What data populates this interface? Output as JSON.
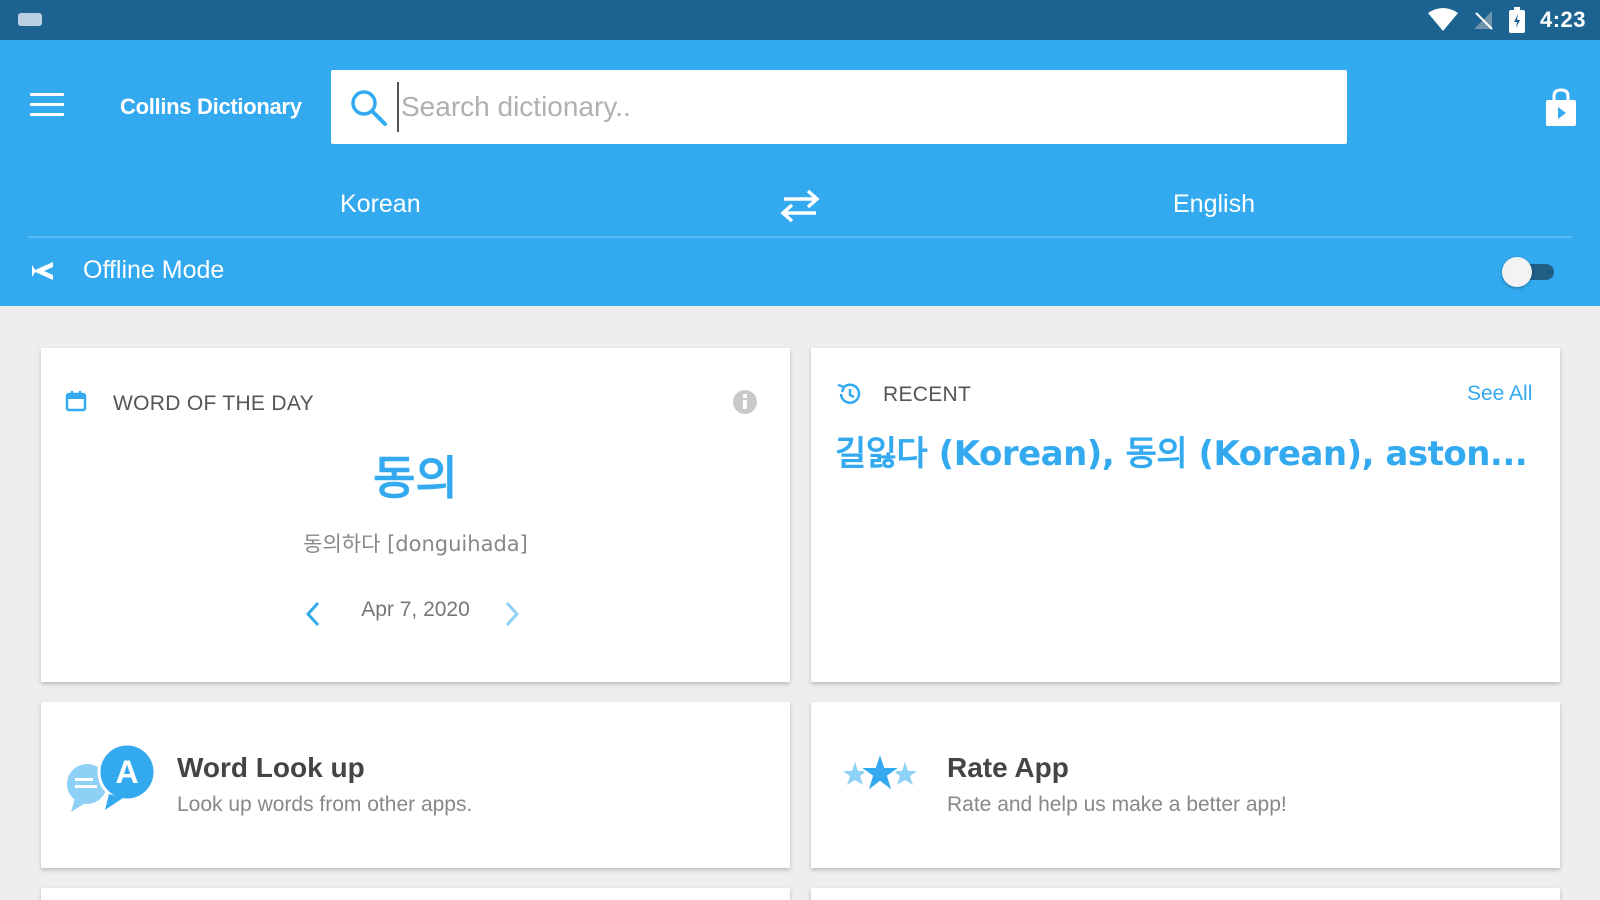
{
  "status_bar": {
    "time": "4:23",
    "icons": [
      "keyboard-icon",
      "wifi-icon",
      "no-signal-icon",
      "battery-icon"
    ]
  },
  "app_bar": {
    "title": "Collins Dictionary",
    "search": {
      "placeholder": "Search dictionary..",
      "value": ""
    },
    "source_language": "Korean",
    "target_language": "English",
    "offline_mode_label": "Offline Mode",
    "offline_mode_on": false
  },
  "word_of_the_day": {
    "header": "WORD OF THE DAY",
    "word": "동의",
    "romanization": "동의하다 [donguihada]",
    "date": "Apr 7, 2020"
  },
  "recent": {
    "header": "RECENT",
    "see_all": "See All",
    "items": "길잃다 (Korean), 동의 (Korean), aston..."
  },
  "features": [
    {
      "title": "Word Look up",
      "subtitle": "Look up words from other apps."
    },
    {
      "title": "Rate App",
      "subtitle": "Rate and help us make a better app!"
    }
  ],
  "colors": {
    "status_bar": "#1c6391",
    "app_bar": "#33aaf0",
    "accent": "#33aaf0",
    "background": "#eeeeee"
  }
}
